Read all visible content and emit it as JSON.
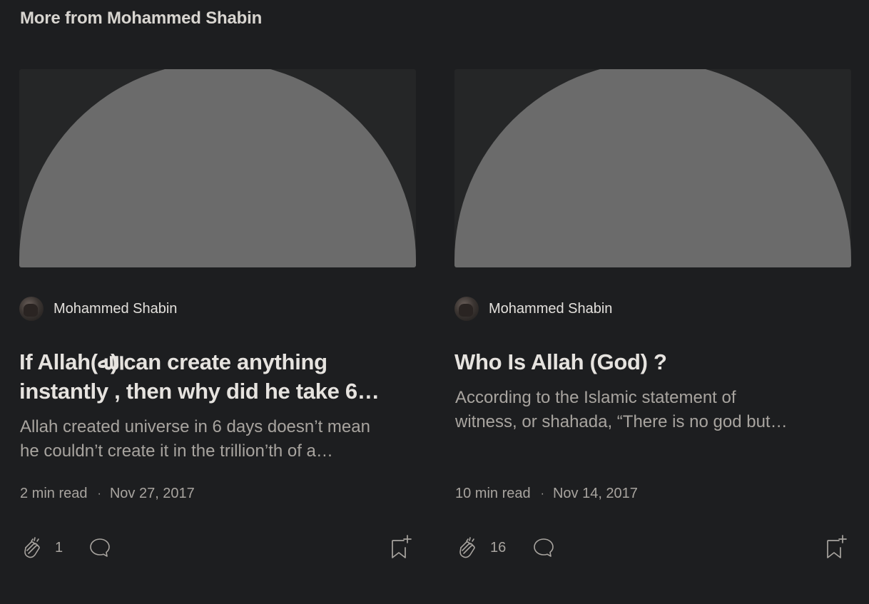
{
  "section": {
    "title": "More from Mohammed Shabin"
  },
  "cards": [
    {
      "author": "Mohammed Shabin",
      "title_line1": "If Allah(ﷲ) can create anything",
      "title_line2": "instantly , then why did he take 6…",
      "subtitle_line1": "Allah created universe in 6 days doesn’t mean",
      "subtitle_line2": "he couldn’t create it in the trillion’th of a…",
      "read_time": "2 min read",
      "separator": "·",
      "date": "Nov 27, 2017",
      "claps": "1",
      "icons": [
        "avatar",
        "clap-icon",
        "comment-icon",
        "bookmark-add-icon"
      ]
    },
    {
      "author": "Mohammed Shabin",
      "title_line1": "Who Is Allah (God) ?",
      "title_line2": "",
      "subtitle_line1": "According to the Islamic statement of",
      "subtitle_line2": "witness, or shahada, “There is no god but…",
      "read_time": "10 min read",
      "separator": "·",
      "date": "Nov 14, 2017",
      "claps": "16",
      "icons": [
        "avatar",
        "clap-icon",
        "comment-icon",
        "bookmark-add-icon"
      ]
    }
  ],
  "colors": {
    "background": "#1d1e20",
    "thumbnail_bg": "#252627",
    "thumbnail_shape": "#6b6b6b",
    "title_text": "#e6e3df",
    "muted_text": "#a8a49f"
  }
}
